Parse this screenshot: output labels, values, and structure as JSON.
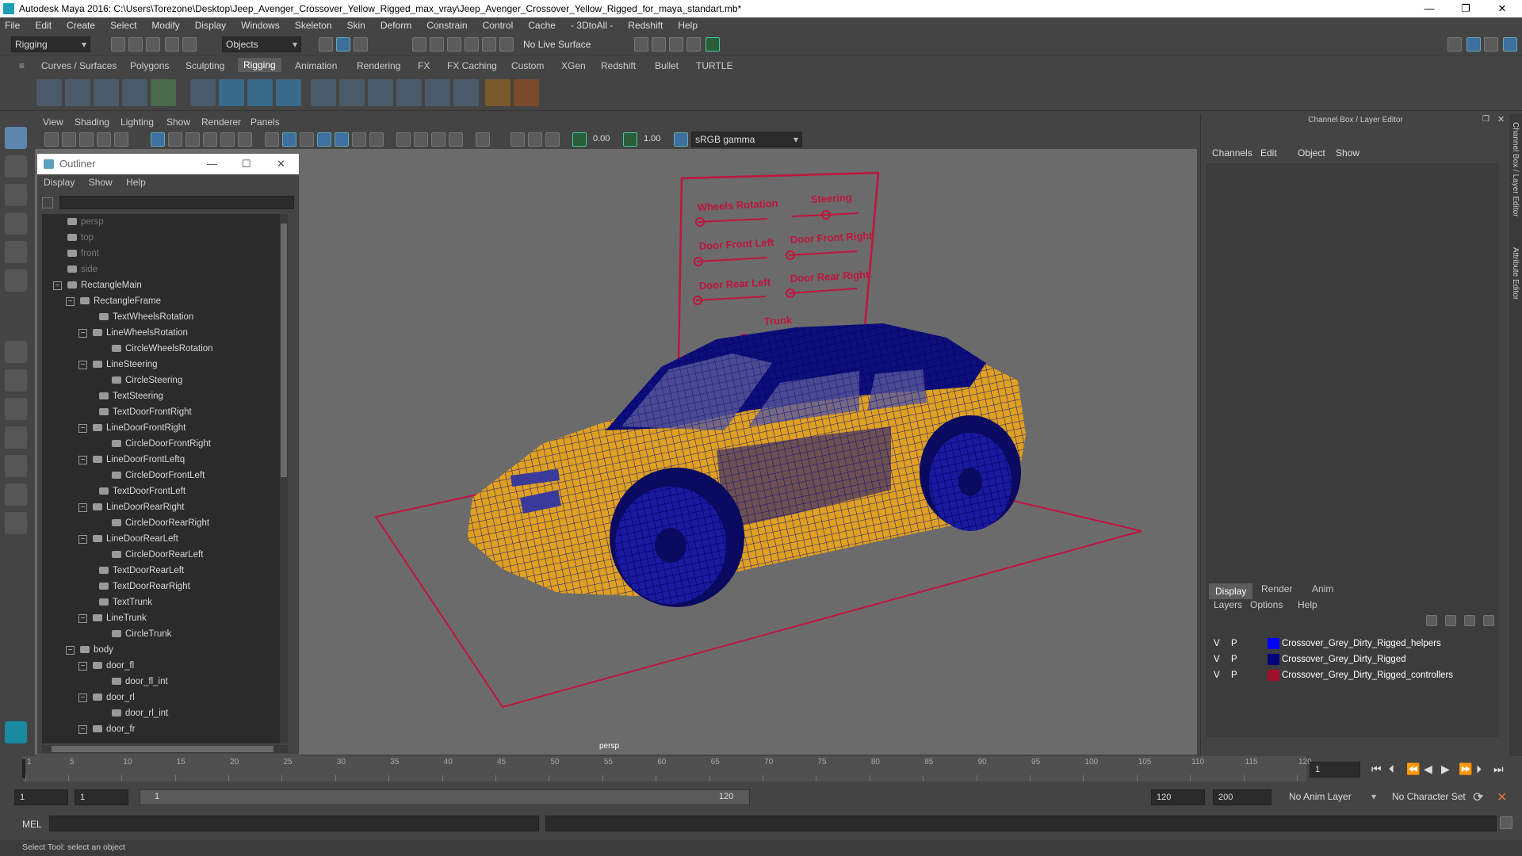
{
  "window": {
    "title": "Autodesk Maya 2016: C:\\Users\\Torezone\\Desktop\\Jeep_Avenger_Crossover_Yellow_Rigged_max_vray\\Jeep_Avenger_Crossover_Yellow_Rigged_for_maya_standart.mb*",
    "minimize": "—",
    "restore": "❐",
    "close": "✕"
  },
  "menubar": [
    "File",
    "Edit",
    "Create",
    "Select",
    "Modify",
    "Display",
    "Windows",
    "Skeleton",
    "Skin",
    "Deform",
    "Constrain",
    "Control",
    "Cache",
    "- 3DtoAll -",
    "Redshift",
    "Help"
  ],
  "status": {
    "mode": "Rigging",
    "selection_mode": "Objects",
    "live_surface": "No Live Surface"
  },
  "shelf_tabs": [
    "Curves / Surfaces",
    "Polygons",
    "Sculpting",
    "Rigging",
    "Animation",
    "Rendering",
    "FX",
    "FX Caching",
    "Custom",
    "XGen",
    "Redshift",
    "Bullet",
    "TURTLE"
  ],
  "shelf_active": "Rigging",
  "viewport": {
    "menus": [
      "View",
      "Shading",
      "Lighting",
      "Show",
      "Renderer",
      "Panels"
    ],
    "exposure": "0.00",
    "gamma": "1.00",
    "color_space": "sRGB gamma",
    "camera_label": "persp"
  },
  "outliner": {
    "title": "Outliner",
    "menus": [
      "Display",
      "Show",
      "Help"
    ],
    "items": [
      {
        "label": "persp",
        "grey": true
      },
      {
        "label": "top",
        "grey": true
      },
      {
        "label": "front",
        "grey": true
      },
      {
        "label": "side",
        "grey": true
      },
      {
        "label": "RectangleMain"
      },
      {
        "label": "RectangleFrame"
      },
      {
        "label": "TextWheelsRotation"
      },
      {
        "label": "LineWheelsRotation"
      },
      {
        "label": "CircleWheelsRotation"
      },
      {
        "label": "LineSteering"
      },
      {
        "label": "CircleSteering"
      },
      {
        "label": "TextSteering"
      },
      {
        "label": "TextDoorFrontRight"
      },
      {
        "label": "LineDoorFrontRight"
      },
      {
        "label": "CircleDoorFrontRight"
      },
      {
        "label": "LineDoorFrontLeftq"
      },
      {
        "label": "CircleDoorFrontLeft"
      },
      {
        "label": "TextDoorFrontLeft"
      },
      {
        "label": "LineDoorRearRight"
      },
      {
        "label": "CircleDoorRearRight"
      },
      {
        "label": "LineDoorRearLeft"
      },
      {
        "label": "CircleDoorRearLeft"
      },
      {
        "label": "TextDoorRearLeft"
      },
      {
        "label": "TextDoorRearRight"
      },
      {
        "label": "TextTrunk"
      },
      {
        "label": "LineTrunk"
      },
      {
        "label": "CircleTrunk"
      },
      {
        "label": "body"
      },
      {
        "label": "door_fl"
      },
      {
        "label": "door_fl_int"
      },
      {
        "label": "door_rl"
      },
      {
        "label": "door_rl_int"
      },
      {
        "label": "door_fr"
      }
    ]
  },
  "control_panel": {
    "wheels_rotation": "Wheels Rotation",
    "steering": "Steering",
    "door_front_left": "Door Front Left",
    "door_front_right": "Door Front Right",
    "door_rear_left": "Door Rear Left",
    "door_rear_right": "Door Rear Right",
    "trunk": "Trunk"
  },
  "channel_box": {
    "title": "Channel Box / Layer Editor",
    "menus": [
      "Channels",
      "Edit",
      "Object",
      "Show"
    ],
    "layer_tabs": [
      "Display",
      "Render",
      "Anim"
    ],
    "layer_active": "Display",
    "layer_menus": [
      "Layers",
      "Options",
      "Help"
    ],
    "layers": [
      {
        "v": "V",
        "p": "P",
        "name": "Crossover_Grey_Dirty_Rigged_helpers",
        "color": "#0000ff"
      },
      {
        "v": "V",
        "p": "P",
        "name": "Crossover_Grey_Dirty_Rigged",
        "color": "#00007a"
      },
      {
        "v": "V",
        "p": "P",
        "name": "Crossover_Grey_Dirty_Rigged_controllers",
        "color": "#a0102a"
      }
    ]
  },
  "side_tabs": [
    "Channel Box / Layer Editor",
    "Attribute Editor"
  ],
  "timeline": {
    "ticks": [
      "1",
      "5",
      "10",
      "15",
      "20",
      "25",
      "30",
      "35",
      "40",
      "45",
      "50",
      "55",
      "60",
      "65",
      "70",
      "75",
      "80",
      "85",
      "90",
      "95",
      "100",
      "105",
      "110",
      "115",
      "120"
    ],
    "current_frame": "1"
  },
  "range": {
    "start": "1",
    "anim_start": "1",
    "slider_start": "1",
    "slider_end": "120",
    "end": "120",
    "anim_end": "200",
    "anim_layer": "No Anim Layer",
    "character_set": "No Character Set"
  },
  "command": {
    "label": "MEL"
  },
  "help_line": "Select Tool: select an object",
  "colors": {
    "accent": "#5d87ad",
    "car_body": "#e0a020",
    "car_wire": "#0a0a8a",
    "controller": "#c0143c"
  }
}
